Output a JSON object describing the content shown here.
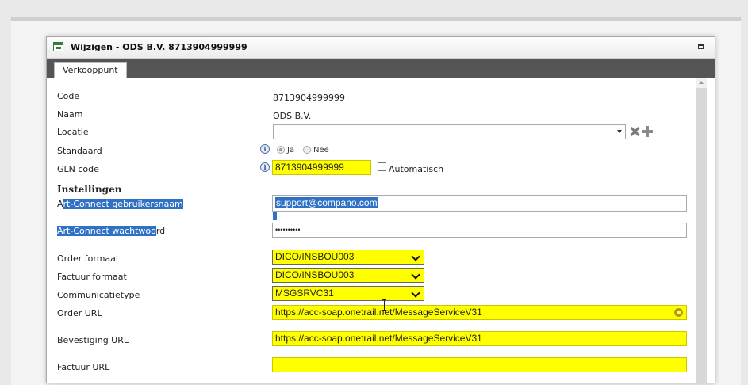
{
  "window": {
    "title": "Wijzigen - ODS B.V. 8713904999999"
  },
  "tabs": [
    {
      "label": "Verkooppunt"
    }
  ],
  "form": {
    "code": {
      "label": "Code",
      "value": "8713904999999"
    },
    "naam": {
      "label": "Naam",
      "value": "ODS B.V."
    },
    "locatie": {
      "label": "Locatie",
      "value": ""
    },
    "standaard": {
      "label": "Standaard",
      "option_ja": "Ja",
      "option_nee": "Nee",
      "selected": "Ja"
    },
    "gln": {
      "label": "GLN code",
      "value": "8713904999999",
      "checkbox_label": "Automatisch"
    },
    "section_title": "Instellingen",
    "artconnect_user": {
      "label_prefix": "A",
      "label_selected": "rt-Connect gebruikersnaam",
      "value": "support@compano.com"
    },
    "artconnect_pass": {
      "label_selected": "Art-Connect wachtwoo",
      "label_suffix": "rd",
      "value": "••••••••••"
    },
    "order_formaat": {
      "label": "Order formaat",
      "value": "DICO/INSBOU003"
    },
    "factuur_formaat": {
      "label": "Factuur formaat",
      "value": "DICO/INSBOU003"
    },
    "communicatietype": {
      "label": "Communicatietype",
      "value": "MSGSRVC31"
    },
    "order_url": {
      "label": "Order URL",
      "value": "https://acc-soap.onetrail.net/MessageServiceV31"
    },
    "bevestiging_url": {
      "label": "Bevestiging URL",
      "value": "https://acc-soap.onetrail.net/MessageServiceV31"
    },
    "factuur_url": {
      "label": "Factuur URL",
      "value": ""
    }
  },
  "colors": {
    "required_yellow": "#ffff00",
    "selection_blue": "#2f71c4",
    "tabbar": "#555555"
  },
  "icons": [
    "form-window-icon",
    "maximize-icon",
    "info-icon",
    "delete-x-icon",
    "add-plus-icon",
    "lock-icon",
    "chevron-down-icon"
  ]
}
